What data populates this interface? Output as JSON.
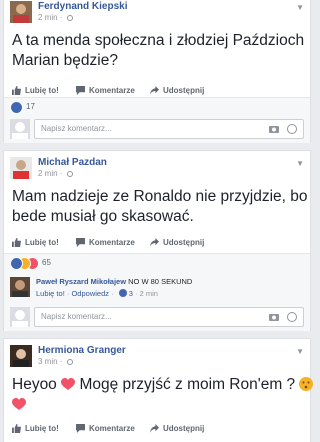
{
  "posts": [
    {
      "author": "Ferdynand Kiepski",
      "time": "2 min",
      "text_line1": "A ta menda społeczna i złodziej Paździoch",
      "text_line2": "Marian będzie?",
      "reactions_count": "17"
    },
    {
      "author": "Michał Pazdan",
      "time": "2 min",
      "text_line1": "Mam nadzieje ze Ronaldo nie przyjdzie, bo",
      "text_line2": "bede musiał go skasować.",
      "reactions_count": "65",
      "reply": {
        "author": "Paweł Ryszard Mikołajew",
        "text": "NO W 80 SEKUND",
        "like": "Lubię to!",
        "respond": "Odpowiedz",
        "likes": "3",
        "time": "2 min"
      }
    },
    {
      "author": "Hermiona Granger",
      "time": "3 min",
      "text_line1a": "Heyoo",
      "text_line1b": "Mogę przyjść z moim Ron'em ?"
    }
  ],
  "actions": {
    "like": "Lubię to!",
    "comment": "Komentarze",
    "share": "Udostępnij"
  },
  "comment_placeholder": "Napisz komentarz...",
  "colors": {
    "link": "#365899",
    "like_blue": "#4267b2",
    "heart_red": "#f25268",
    "haha_yellow": "#f7b125"
  }
}
